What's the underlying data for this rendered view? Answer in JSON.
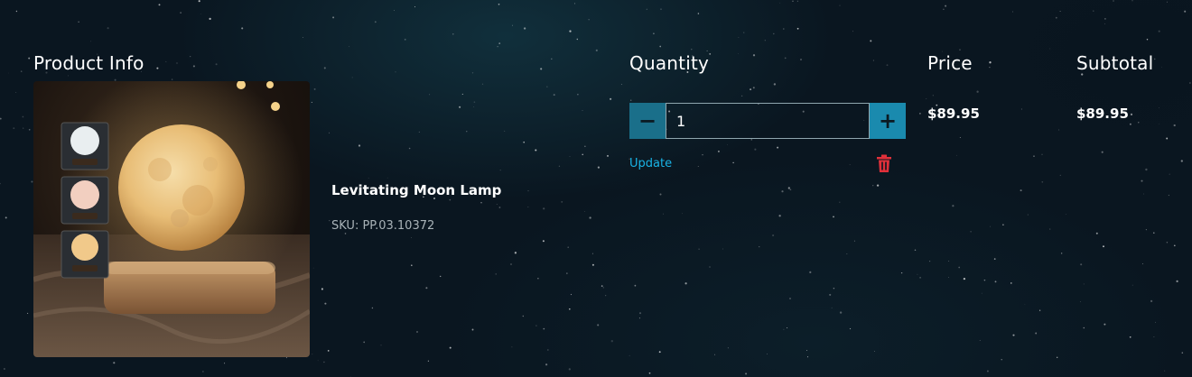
{
  "headers": {
    "product_info": "Product Info",
    "quantity": "Quantity",
    "price": "Price",
    "subtotal": "Subtotal"
  },
  "item": {
    "image_name": "levitating-moon-lamp-photo",
    "name": "Levitating Moon Lamp",
    "sku": "SKU: PP.03.10372",
    "quantity": "1",
    "price": "$89.95",
    "subtotal": "$89.95"
  },
  "controls": {
    "decrease_icon": "minus-icon",
    "increase_icon": "plus-icon",
    "decrease_symbol": "−",
    "increase_symbol": "+",
    "update_label": "Update",
    "remove_icon": "trash-icon"
  },
  "colors": {
    "accent": "#19b3e6",
    "stepper": "#1a6f8a",
    "remove": "#e0303a",
    "background": "#0a1620"
  }
}
